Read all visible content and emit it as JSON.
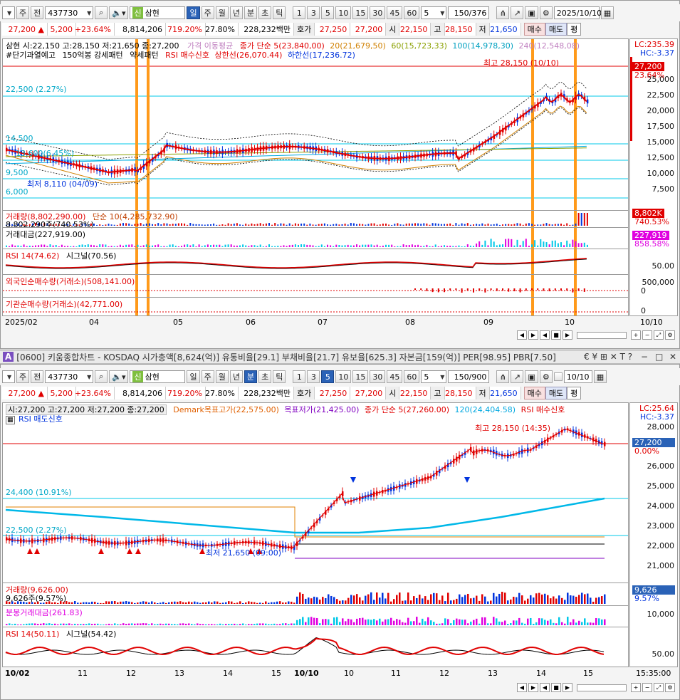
{
  "top": {
    "toolbar": {
      "period_btn": "주",
      "prev_btn": "전",
      "code": "437730",
      "badge": "신",
      "name": "삼현",
      "tf": [
        "일",
        "주",
        "월",
        "년",
        "분",
        "초",
        "틱"
      ],
      "tf_active": 0,
      "nums": [
        "1",
        "3",
        "5",
        "10",
        "15",
        "30",
        "45",
        "60"
      ],
      "num_sel": "5",
      "count": "150",
      "count_total": "/376",
      "date": "2025/10/10"
    },
    "quote": {
      "price": "27,200",
      "change": "5,200",
      "pct": "+23.64%",
      "volume": "8,814,206",
      "vol_ratio": "719.20%",
      "turnover": "27.80%",
      "amount": "228,232백만",
      "hoga_label": "호가",
      "hoga1": "27,250",
      "hoga2": "27,200",
      "open_label": "시",
      "open": "22,150",
      "high_label": "고",
      "high": "28,150",
      "low_label": "저",
      "low": "21,650",
      "buy": "매수",
      "sell": "매도",
      "sim": "평"
    },
    "legend1": {
      "ohlc": "삼현 시:22,150 고:28,150 저:21,650 종:27,200",
      "ma_label": "가격 이동평균",
      "ma5": "종가 단순 5(23,840,00)",
      "ma20": "20(21,679,50)",
      "ma60": "60(15,723,33)",
      "ma100": "100(14,978,30)",
      "ma240": "240(12,548,08)"
    },
    "legend2": {
      "warn": "#단기과열예고",
      "pattern": "150억봉 강세패턴",
      "weak": "약세패턴",
      "rsi_signal": "RSI 매수신호",
      "upper": "상한선(26,070.44)",
      "lower": "하한선(17,236.72)"
    },
    "annotations": {
      "level_22500": "22,500 (2.27%)",
      "level_14500": "14,500",
      "level_13600": "13,600(6.45%)",
      "level_9500": "9,500",
      "level_6000": "6,000",
      "low": "최저 8,110 (04/09)",
      "high": "최고 28,150 (10/10)"
    },
    "yaxis": [
      "25,000",
      "22,500",
      "20,000",
      "17,500",
      "15,000",
      "12,500",
      "10,000",
      "7,500"
    ],
    "lc": "LC:235.39",
    "hc": "HC:-3.37",
    "price_tag": "27,200",
    "pct_tag": "23.64%",
    "volume_legend": "거래량(8,802,290.00)",
    "volume_ma": "단순 10(4,285,732.90)",
    "volume_sub": "8,802,290주(740.53%)",
    "vol_tag": "8,802K",
    "vol_pct_tag": "740.53%",
    "amount_legend": "거래대금(227,919.00)",
    "amt_tag": "227,919",
    "amt_pct_tag": "858.58%",
    "rsi_legend": "RSI 14(74.62)",
    "rsi_sig": "시그널(70.56)",
    "rsi_tick": "50.00",
    "foreign_legend": "외국인순매수량(거래소)(508,141.00)",
    "foreign_ticks": [
      "500,000",
      "0"
    ],
    "inst_legend": "기관순매수량(거래소)(42,771.00)",
    "inst_tick": "0",
    "xaxis": [
      "2025/02",
      "04",
      "05",
      "06",
      "07",
      "08",
      "09",
      "10",
      "10/10"
    ]
  },
  "title": {
    "text": "[0600] 키움종합차트 - KOSDAQ 시가총액[8,624(억)] 유통비율[29.1] 부채비율[21.7] 유보율[625.3] 자본금[159(억)] PER[98.95] PBR[7.50]",
    "badge": "A",
    "tools": "€ ¥ ⊞ ✕ T ?"
  },
  "bottom": {
    "toolbar": {
      "period_btn": "주",
      "prev_btn": "전",
      "code": "437730",
      "badge": "신",
      "name": "삼현",
      "tf": [
        "일",
        "주",
        "월",
        "년",
        "분",
        "초",
        "틱"
      ],
      "tf_active": 4,
      "nums": [
        "1",
        "3",
        "5",
        "10",
        "15",
        "30",
        "45",
        "60"
      ],
      "num_sel": "5",
      "count": "150",
      "count_total": "/900",
      "date": "10/10"
    },
    "legend1": {
      "ohlc": "시:27,200 고:27,200 저:27,200 종:27,200",
      "demark_h": "Demark목표고가(22,575.00)",
      "demark_l": "목표저가(21,425.00)",
      "ma5": "종가 단순 5(27,260.00)",
      "ma120": "120(24,404.58)",
      "rsi_buy": "RSI 매수신호",
      "rsi_sell": "RSI 매도신호"
    },
    "annotations": {
      "level_24400": "24,400 (10.91%)",
      "level_22500": "22,500 (2.27%)",
      "low": "최저 21,650 (09:00)",
      "high": "최고 28,150 (14:35)"
    },
    "yaxis": [
      "28,000",
      "26,000",
      "25,000",
      "24,000",
      "23,000",
      "22,000",
      "21,000"
    ],
    "lc": "LC:25.64",
    "hc": "HC:-3.37",
    "price_tag": "27,200",
    "pct_tag": "0.00%",
    "volume_legend": "거래량(9,626.00)",
    "volume_sub": "9,626주(9.57%)",
    "vol_tag": "9,626",
    "vol_pct": "9.57%",
    "amount_legend": "분봉거래대금(261.83)",
    "amt_tick": "10,000",
    "rsi_legend": "RSI 14(50.11)",
    "rsi_sig": "시그널(54.42)",
    "rsi_tick": "50.00",
    "xaxis": [
      "10/02",
      "11",
      "12",
      "13",
      "14",
      "15",
      "10/10",
      "10",
      "11",
      "12",
      "13",
      "14",
      "15"
    ],
    "time": "15:35:00"
  },
  "colors": {
    "up": "#e00000",
    "down": "#0033dd",
    "accent": "#2a62b7",
    "orange": "#ff8c00",
    "cyan": "#00c8e8"
  }
}
